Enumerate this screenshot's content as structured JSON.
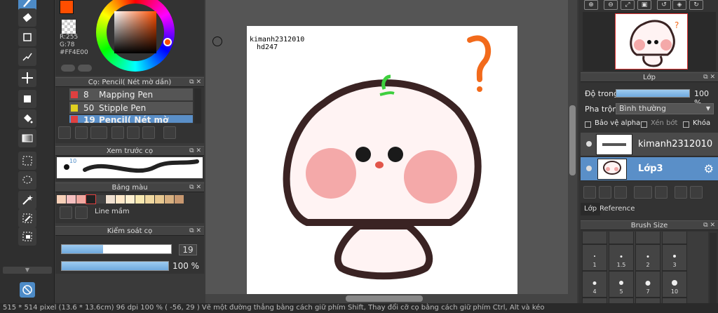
{
  "color": {
    "main_hex": "#FF4E00",
    "r_label": "R:255",
    "g_label": "G:78",
    "hex_label": "#FF4E00"
  },
  "brush_panel": {
    "title": "Cọ: Pencil( Nét mờ dần)",
    "brushes": [
      {
        "size": "8",
        "name": "Mapping Pen",
        "color": "#e04040"
      },
      {
        "size": "50",
        "name": "Stipple Pen",
        "color": "#e0d020"
      },
      {
        "size": "19",
        "name": "Pencil( Nét mờ dần)",
        "color": "#e04040"
      }
    ]
  },
  "preview_panel": {
    "title": "Xem trước cọ",
    "size_label": "10"
  },
  "palette_panel": {
    "title": "Bảng màu",
    "line_label": "Line mầm",
    "swatches": [
      "#f7d0b8",
      "#f5c0c0",
      "#f0a8a0",
      "#222222",
      "#444444",
      "#f0e0d0",
      "#ffe8c8",
      "#fff0d0",
      "#f8e8b0",
      "#f0d8a0",
      "#e8c890",
      "#d8b080",
      "#c89870"
    ]
  },
  "control_panel": {
    "title": "Kiểm soát cọ",
    "size_value": "19",
    "opacity_value": "100 %"
  },
  "canvas": {
    "author_line1": "kimanh2312010",
    "author_line2": "hd247"
  },
  "layer_panel": {
    "title": "Lớp",
    "opacity_label": "Độ trong",
    "opacity_value": "100 %",
    "blend_label": "Pha trộn",
    "blend_value": "Bình thường",
    "protect_alpha": "Bảo vệ alpha",
    "clipping": "Xén bớt",
    "lock": "Khóa",
    "layers": [
      {
        "name": "kimanh2312010"
      },
      {
        "name": "Lớp3"
      }
    ],
    "tabs": [
      "Lớp",
      "Reference"
    ]
  },
  "brush_size_panel": {
    "title": "Brush Size",
    "values": [
      "",
      "",
      "",
      "",
      "1",
      "1.5",
      "2",
      "3",
      "4",
      "5",
      "7",
      "10",
      "",
      "",
      "",
      ""
    ]
  },
  "status": {
    "text": "515 * 514 pixel   (13.6 * 13.6cm)   96 dpi   100 %   ( -56, 29 )   Vẽ một đường thẳng bằng cách giữ phím Shift, Thay đổi cỡ cọ bằng cách giữ phím Ctrl, Alt và kéo"
  }
}
